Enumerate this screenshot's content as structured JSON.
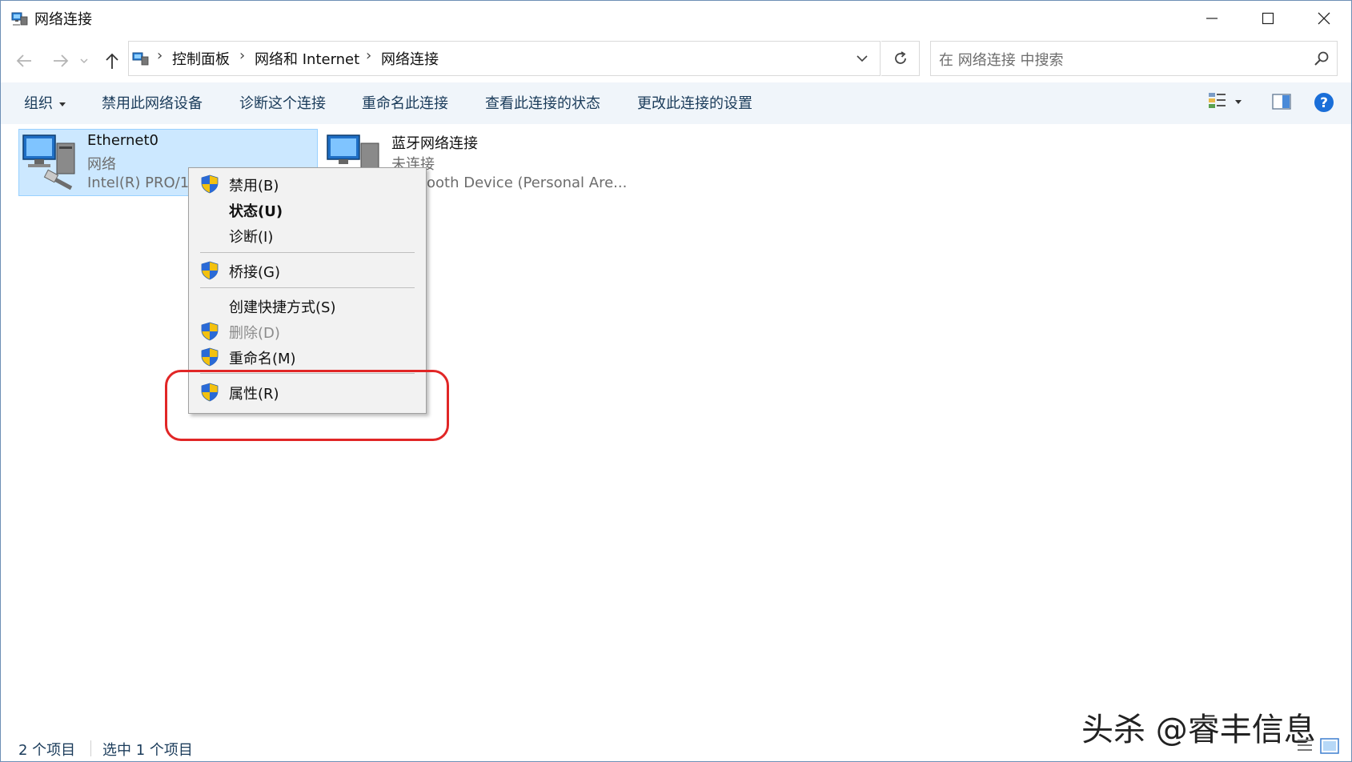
{
  "window": {
    "title": "网络连接"
  },
  "address": {
    "crumbs": [
      "控制面板",
      "网络和 Internet",
      "网络连接"
    ]
  },
  "search": {
    "placeholder": "在 网络连接 中搜索"
  },
  "toolbar": {
    "items": [
      "组织",
      "禁用此网络设备",
      "诊断这个连接",
      "重命名此连接",
      "查看此连接的状态",
      "更改此连接的设置"
    ]
  },
  "connections": [
    {
      "name": "Ethernet0",
      "status": "网络",
      "device": "Intel(R) PRO/1"
    },
    {
      "name": "蓝牙网络连接",
      "status": "未连接",
      "device": "ooth Device (Personal Are..."
    }
  ],
  "context_menu": {
    "items": [
      {
        "label": "禁用(B)",
        "shield": true,
        "bold": false,
        "disabled": false
      },
      {
        "label": "状态(U)",
        "shield": false,
        "bold": true,
        "disabled": false
      },
      {
        "label": "诊断(I)",
        "shield": false,
        "bold": false,
        "disabled": false
      },
      {
        "label": "桥接(G)",
        "shield": true,
        "bold": false,
        "disabled": false
      },
      {
        "label": "创建快捷方式(S)",
        "shield": false,
        "bold": false,
        "disabled": false
      },
      {
        "label": "删除(D)",
        "shield": true,
        "bold": false,
        "disabled": true
      },
      {
        "label": "重命名(M)",
        "shield": true,
        "bold": false,
        "disabled": false
      },
      {
        "label": "属性(R)",
        "shield": true,
        "bold": false,
        "disabled": false
      }
    ]
  },
  "status_bar": {
    "count": "2 个项目",
    "selected": "选中 1 个项目"
  },
  "watermark": "头杀 @睿丰信息",
  "colors": {
    "selection": "#cce8ff",
    "highlight_ring": "#e12626",
    "command_bar": "#f0f5fa",
    "help": "#1a6ed8"
  },
  "icons": [
    "network-folder-icon",
    "back-arrow-icon",
    "forward-arrow-icon",
    "up-arrow-icon",
    "refresh-icon",
    "search-icon",
    "view-icon",
    "preview-pane-icon",
    "help-icon",
    "uac-shield-icon",
    "network-adapter-icon"
  ]
}
